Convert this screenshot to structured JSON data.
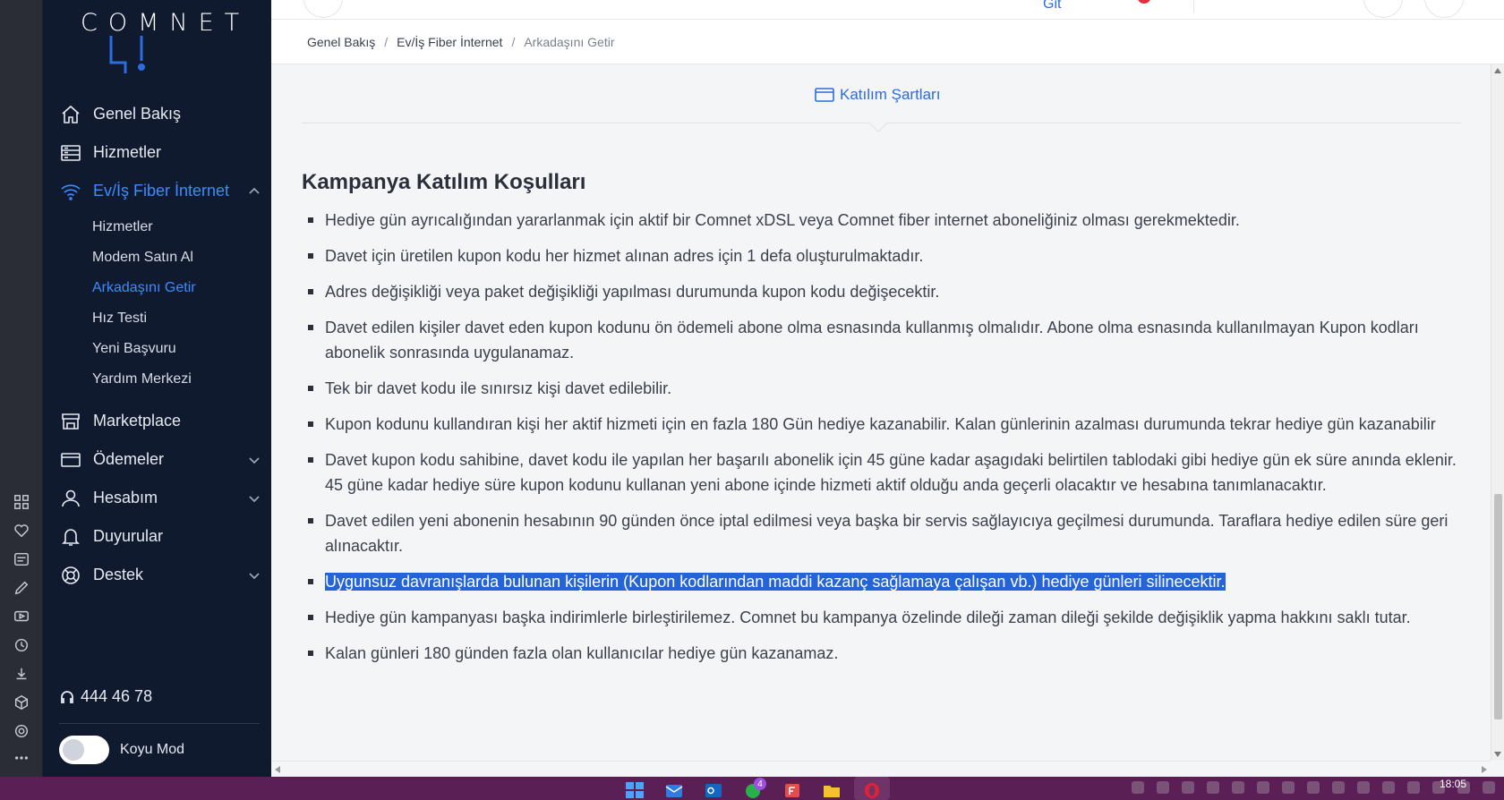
{
  "sidebar": {
    "logo_text": "COMNET",
    "nav": [
      {
        "label": "Genel Bakış",
        "icon": "home-icon"
      },
      {
        "label": "Hizmetler",
        "icon": "server-icon"
      },
      {
        "label": "Ev/İş Fiber İnternet",
        "icon": "wifi-icon",
        "active": true,
        "expanded": true
      },
      {
        "label": "Marketplace",
        "icon": "store-icon"
      },
      {
        "label": "Ödemeler",
        "icon": "credit-card-icon"
      },
      {
        "label": "Hesabım",
        "icon": "user-icon"
      },
      {
        "label": "Duyurular",
        "icon": "bell-icon"
      },
      {
        "label": "Destek",
        "icon": "lifebuoy-icon"
      }
    ],
    "subnav": [
      {
        "label": "Hizmetler"
      },
      {
        "label": "Modem Satın Al"
      },
      {
        "label": "Arkadaşını Getir",
        "active": true
      },
      {
        "label": "Hız Testi"
      },
      {
        "label": "Yeni Başvuru"
      },
      {
        "label": "Yardım Merkezi"
      }
    ],
    "phone": "444 46 78",
    "dark_mode_label": "Koyu Mod",
    "dark_mode_on": false
  },
  "topbar": {
    "partial_link": "Git"
  },
  "breadcrumb": {
    "items": [
      "Genel Bakış",
      "Ev/İş Fiber İnternet",
      "Arkadaşını Getir"
    ]
  },
  "tab": {
    "label": "Katılım Şartları"
  },
  "content": {
    "title": "Kampanya Katılım Koşulları",
    "terms": [
      "Hediye gün ayrıcalığından yararlanmak için aktif bir Comnet xDSL veya Comnet fiber internet aboneliğiniz olması gerekmektedir.",
      "Davet için üretilen kupon kodu her hizmet alınan adres için 1 defa oluşturulmaktadır.",
      "Adres değişikliği veya paket değişikliği yapılması durumunda kupon kodu değişecektir.",
      "Davet edilen kişiler davet eden kupon kodunu ön ödemeli abone olma esnasında kullanmış olmalıdır. Abone olma esnasında kullanılmayan Kupon kodları abonelik sonrasında uygulanamaz.",
      "Tek bir davet kodu ile sınırsız kişi davet edilebilir.",
      "Kupon kodunu kullandıran kişi her aktif hizmeti için en fazla 180 Gün hediye kazanabilir. Kalan günlerinin azalması durumunda tekrar hediye gün kazanabilir",
      "Davet kupon kodu sahibine, davet kodu ile yapılan her başarılı abonelik için 45 güne kadar aşagıdaki belirtilen tablodaki gibi hediye gün ek süre anında eklenir. 45 güne kadar hediye süre kupon kodunu kullanan yeni abone içinde hizmeti aktif olduğu anda geçerli olacaktır ve hesabına tanımlanacaktır.",
      "Davet edilen yeni abonenin hesabının 90 günden önce iptal edilmesi veya başka bir servis sağlayıcıya geçilmesi durumunda. Taraflara hediye edilen süre geri alınacaktır.",
      "Uygunsuz davranışlarda bulunan kişilerin (Kupon kodlarından maddi kazanç sağlamaya çalışan vb.) hediye günleri silinecektir.",
      "Hediye gün kampanyası başka indirimlerle birleştirilemez. Comnet bu kampanya özelinde dileği zaman dileği şekilde değişiklik yapma hakkını saklı tutar.",
      "Kalan günleri 180 günden fazla olan kullanıcılar hediye gün kazanamaz."
    ],
    "selected_index": 8
  },
  "taskbar": {
    "whatsapp_badge": "4",
    "clock": "18:05"
  },
  "colors": {
    "sidebar_bg": "#0f1a2e",
    "accent": "#3d8bff",
    "link": "#2d6cdf",
    "selection": "#2563d8",
    "taskbar": "#5a1f55"
  }
}
